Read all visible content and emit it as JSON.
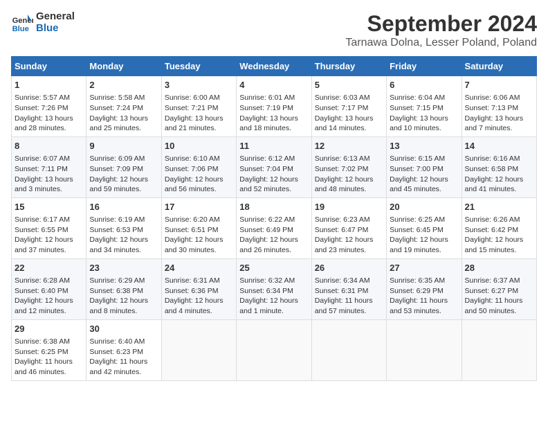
{
  "logo": {
    "line1": "General",
    "line2": "Blue"
  },
  "title": "September 2024",
  "subtitle": "Tarnawa Dolna, Lesser Poland, Poland",
  "weekdays": [
    "Sunday",
    "Monday",
    "Tuesday",
    "Wednesday",
    "Thursday",
    "Friday",
    "Saturday"
  ],
  "weeks": [
    [
      {
        "day": 1,
        "info": "Sunrise: 5:57 AM\nSunset: 7:26 PM\nDaylight: 13 hours\nand 28 minutes."
      },
      {
        "day": 2,
        "info": "Sunrise: 5:58 AM\nSunset: 7:24 PM\nDaylight: 13 hours\nand 25 minutes."
      },
      {
        "day": 3,
        "info": "Sunrise: 6:00 AM\nSunset: 7:21 PM\nDaylight: 13 hours\nand 21 minutes."
      },
      {
        "day": 4,
        "info": "Sunrise: 6:01 AM\nSunset: 7:19 PM\nDaylight: 13 hours\nand 18 minutes."
      },
      {
        "day": 5,
        "info": "Sunrise: 6:03 AM\nSunset: 7:17 PM\nDaylight: 13 hours\nand 14 minutes."
      },
      {
        "day": 6,
        "info": "Sunrise: 6:04 AM\nSunset: 7:15 PM\nDaylight: 13 hours\nand 10 minutes."
      },
      {
        "day": 7,
        "info": "Sunrise: 6:06 AM\nSunset: 7:13 PM\nDaylight: 13 hours\nand 7 minutes."
      }
    ],
    [
      {
        "day": 8,
        "info": "Sunrise: 6:07 AM\nSunset: 7:11 PM\nDaylight: 13 hours\nand 3 minutes."
      },
      {
        "day": 9,
        "info": "Sunrise: 6:09 AM\nSunset: 7:09 PM\nDaylight: 12 hours\nand 59 minutes."
      },
      {
        "day": 10,
        "info": "Sunrise: 6:10 AM\nSunset: 7:06 PM\nDaylight: 12 hours\nand 56 minutes."
      },
      {
        "day": 11,
        "info": "Sunrise: 6:12 AM\nSunset: 7:04 PM\nDaylight: 12 hours\nand 52 minutes."
      },
      {
        "day": 12,
        "info": "Sunrise: 6:13 AM\nSunset: 7:02 PM\nDaylight: 12 hours\nand 48 minutes."
      },
      {
        "day": 13,
        "info": "Sunrise: 6:15 AM\nSunset: 7:00 PM\nDaylight: 12 hours\nand 45 minutes."
      },
      {
        "day": 14,
        "info": "Sunrise: 6:16 AM\nSunset: 6:58 PM\nDaylight: 12 hours\nand 41 minutes."
      }
    ],
    [
      {
        "day": 15,
        "info": "Sunrise: 6:17 AM\nSunset: 6:55 PM\nDaylight: 12 hours\nand 37 minutes."
      },
      {
        "day": 16,
        "info": "Sunrise: 6:19 AM\nSunset: 6:53 PM\nDaylight: 12 hours\nand 34 minutes."
      },
      {
        "day": 17,
        "info": "Sunrise: 6:20 AM\nSunset: 6:51 PM\nDaylight: 12 hours\nand 30 minutes."
      },
      {
        "day": 18,
        "info": "Sunrise: 6:22 AM\nSunset: 6:49 PM\nDaylight: 12 hours\nand 26 minutes."
      },
      {
        "day": 19,
        "info": "Sunrise: 6:23 AM\nSunset: 6:47 PM\nDaylight: 12 hours\nand 23 minutes."
      },
      {
        "day": 20,
        "info": "Sunrise: 6:25 AM\nSunset: 6:45 PM\nDaylight: 12 hours\nand 19 minutes."
      },
      {
        "day": 21,
        "info": "Sunrise: 6:26 AM\nSunset: 6:42 PM\nDaylight: 12 hours\nand 15 minutes."
      }
    ],
    [
      {
        "day": 22,
        "info": "Sunrise: 6:28 AM\nSunset: 6:40 PM\nDaylight: 12 hours\nand 12 minutes."
      },
      {
        "day": 23,
        "info": "Sunrise: 6:29 AM\nSunset: 6:38 PM\nDaylight: 12 hours\nand 8 minutes."
      },
      {
        "day": 24,
        "info": "Sunrise: 6:31 AM\nSunset: 6:36 PM\nDaylight: 12 hours\nand 4 minutes."
      },
      {
        "day": 25,
        "info": "Sunrise: 6:32 AM\nSunset: 6:34 PM\nDaylight: 12 hours\nand 1 minute."
      },
      {
        "day": 26,
        "info": "Sunrise: 6:34 AM\nSunset: 6:31 PM\nDaylight: 11 hours\nand 57 minutes."
      },
      {
        "day": 27,
        "info": "Sunrise: 6:35 AM\nSunset: 6:29 PM\nDaylight: 11 hours\nand 53 minutes."
      },
      {
        "day": 28,
        "info": "Sunrise: 6:37 AM\nSunset: 6:27 PM\nDaylight: 11 hours\nand 50 minutes."
      }
    ],
    [
      {
        "day": 29,
        "info": "Sunrise: 6:38 AM\nSunset: 6:25 PM\nDaylight: 11 hours\nand 46 minutes."
      },
      {
        "day": 30,
        "info": "Sunrise: 6:40 AM\nSunset: 6:23 PM\nDaylight: 11 hours\nand 42 minutes."
      },
      null,
      null,
      null,
      null,
      null
    ]
  ]
}
